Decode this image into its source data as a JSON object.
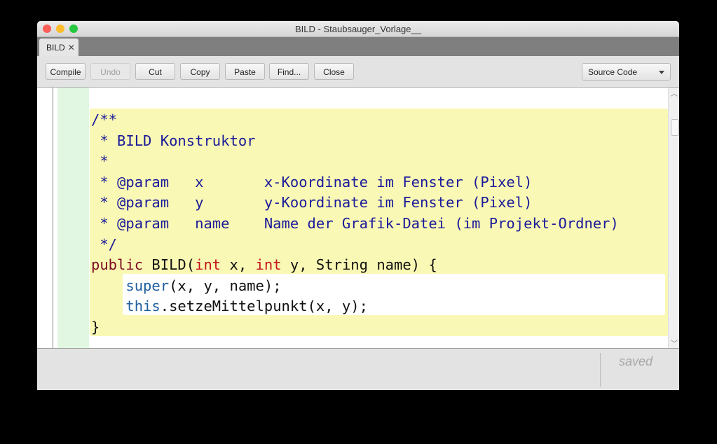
{
  "window": {
    "title": "BILD - Staubsauger_Vorlage__",
    "traffic_lights": [
      "#fd5f57",
      "#fdbc2e",
      "#27c840"
    ]
  },
  "tabs": [
    {
      "label": "BILD",
      "close_icon": "close-icon"
    }
  ],
  "toolbar": {
    "buttons": [
      {
        "label": "Compile",
        "enabled": true
      },
      {
        "label": "Undo",
        "enabled": false
      },
      {
        "label": "Cut",
        "enabled": true
      },
      {
        "label": "Copy",
        "enabled": true
      },
      {
        "label": "Paste",
        "enabled": true
      },
      {
        "label": "Find...",
        "enabled": true
      },
      {
        "label": "Close",
        "enabled": true
      }
    ],
    "view_select": "Source Code"
  },
  "code_lines": [
    [
      {
        "t": "/**",
        "c": "c"
      }
    ],
    [
      {
        "t": " * BILD Konstruktor",
        "c": "c"
      }
    ],
    [
      {
        "t": " *",
        "c": "c"
      }
    ],
    [
      {
        "t": " * @param   x       x-Koordinate im Fenster (Pixel)",
        "c": "c"
      }
    ],
    [
      {
        "t": " * @param   y       y-Koordinate im Fenster (Pixel)",
        "c": "c"
      }
    ],
    [
      {
        "t": " * @param   name    Name der Grafik-Datei (im Projekt-Ordner)",
        "c": "c"
      }
    ],
    [
      {
        "t": " */",
        "c": "c"
      }
    ],
    [
      {
        "t": "public",
        "c": "kw"
      },
      {
        "t": " BILD(",
        "c": ""
      },
      {
        "t": "int",
        "c": "ty"
      },
      {
        "t": " x, ",
        "c": ""
      },
      {
        "t": "int",
        "c": "ty"
      },
      {
        "t": " y, String name) {",
        "c": ""
      }
    ],
    [
      {
        "t": "    ",
        "c": ""
      },
      {
        "t": "super",
        "c": "sp"
      },
      {
        "t": "(x, y, name);",
        "c": ""
      }
    ],
    [
      {
        "t": "    ",
        "c": ""
      },
      {
        "t": "this",
        "c": "sp"
      },
      {
        "t": ".setzeMittelpunkt(x, y);",
        "c": ""
      }
    ],
    [
      {
        "t": "}",
        "c": ""
      }
    ]
  ],
  "status": {
    "text": "saved"
  }
}
